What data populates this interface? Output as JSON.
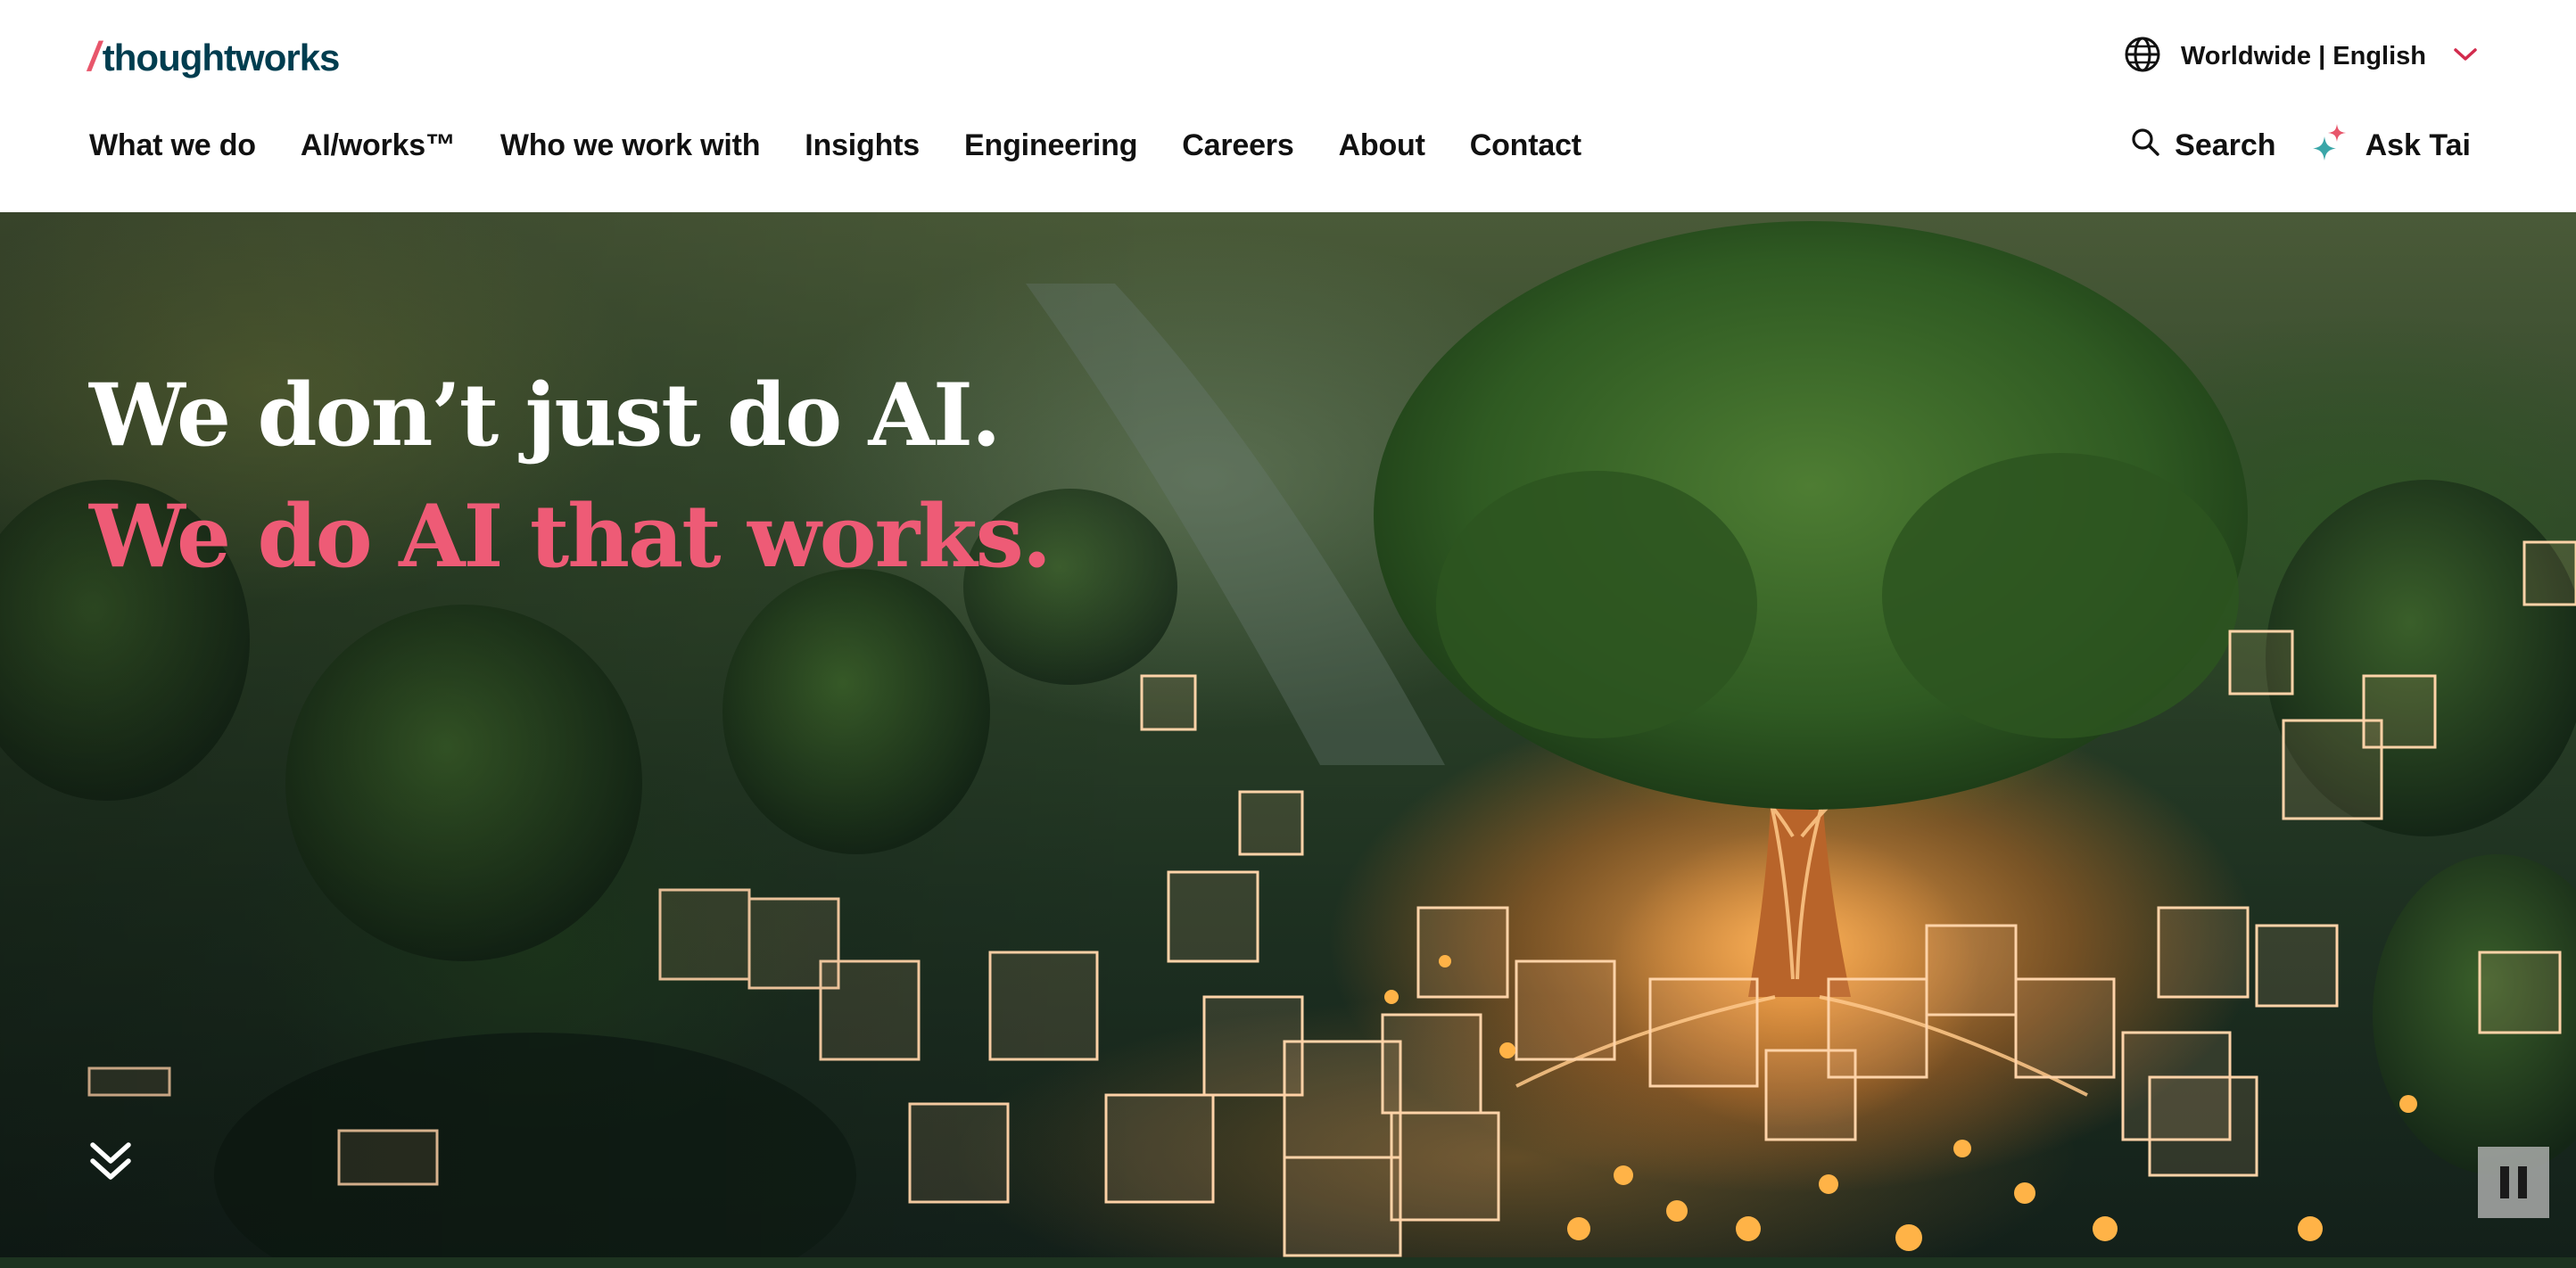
{
  "header": {
    "logo": {
      "slash": "/",
      "text": "thoughtworks"
    },
    "locale": {
      "label": "Worldwide | English",
      "globe_icon": "globe-icon",
      "chevron_icon": "chevron-down-icon"
    }
  },
  "nav": {
    "items": [
      {
        "label": "What we do"
      },
      {
        "label": "AI/works™"
      },
      {
        "label": "Who we work with"
      },
      {
        "label": "Insights"
      },
      {
        "label": "Engineering"
      },
      {
        "label": "Careers"
      },
      {
        "label": "About"
      },
      {
        "label": "Contact"
      }
    ]
  },
  "utility": {
    "search": {
      "label": "Search",
      "icon": "search-icon"
    },
    "ask": {
      "label": "Ask Tai",
      "icon": "sparkle-icon"
    }
  },
  "hero": {
    "headline_line1": "We don’t just do AI.",
    "headline_line2": "We do AI that works.",
    "scroll_icon": "double-chevron-down-icon",
    "pause_icon": "pause-icon"
  },
  "colors": {
    "brand_pink": "#ee5b76",
    "brand_teal": "#003d4f",
    "text": "#111111",
    "locale_chevron": "#d22b4d"
  }
}
